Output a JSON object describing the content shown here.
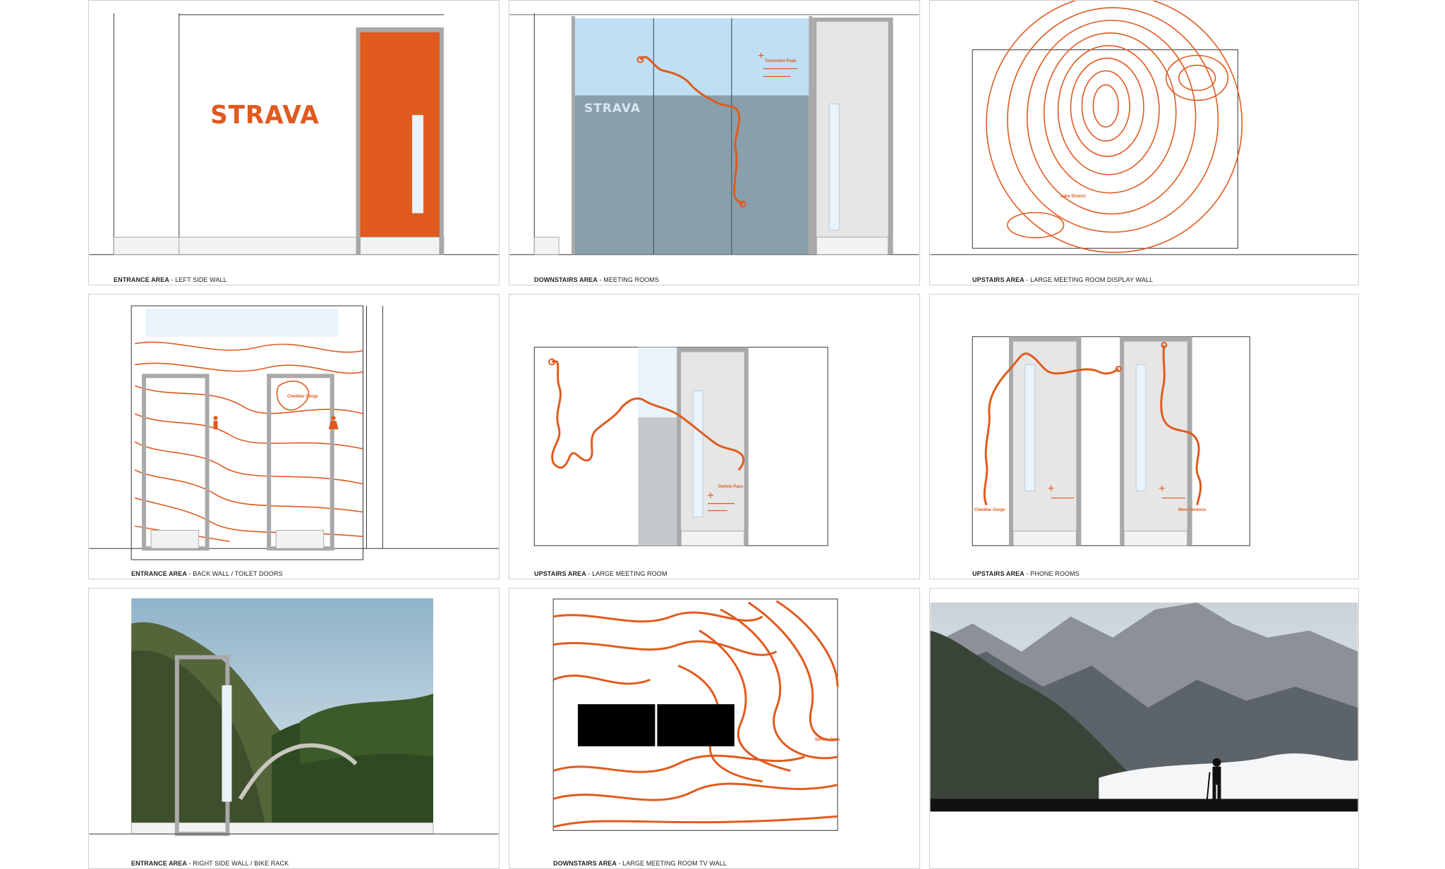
{
  "brand": {
    "name": "STRAVA",
    "accent_color": "#e05a1e",
    "glass_color": "#e8f3fb",
    "grey_frame": "#a9a9a9"
  },
  "panels": [
    {
      "area": "ENTRANCE AREA",
      "desc": " - LEFT SIDE WALL"
    },
    {
      "area": "DOWNSTAIRS AREA",
      "desc": " - MEETING ROOMS"
    },
    {
      "area": "UPSTAIRS AREA",
      "desc": " - LARGE MEETING ROOM DISPLAY WALL"
    },
    {
      "area": "ENTRANCE AREA",
      "desc": " - BACK WALL / TOILET DOORS"
    },
    {
      "area": "UPSTAIRS AREA",
      "desc": " - LARGE MEETING ROOM"
    },
    {
      "area": "UPSTAIRS AREA",
      "desc": " - PHONE ROOMS"
    },
    {
      "area": "ENTRANCE AREA",
      "desc": " - RIGHT SIDE WALL / BIKE RACK"
    },
    {
      "area": "DOWNSTAIRS AREA",
      "desc": " - LARGE MEETING ROOM TV WALL"
    }
  ],
  "map_labels": {
    "cheddar_gorge": "Cheddar Gorge",
    "tour_peak": "Tourmalet Peak",
    "mont_ventoux": "Mont Ventoux",
    "lake": "Lake District",
    "pass": "Stelvio Pass"
  },
  "icons": {
    "male_toilet": "male-figure-icon",
    "female_toilet": "female-figure-icon"
  }
}
